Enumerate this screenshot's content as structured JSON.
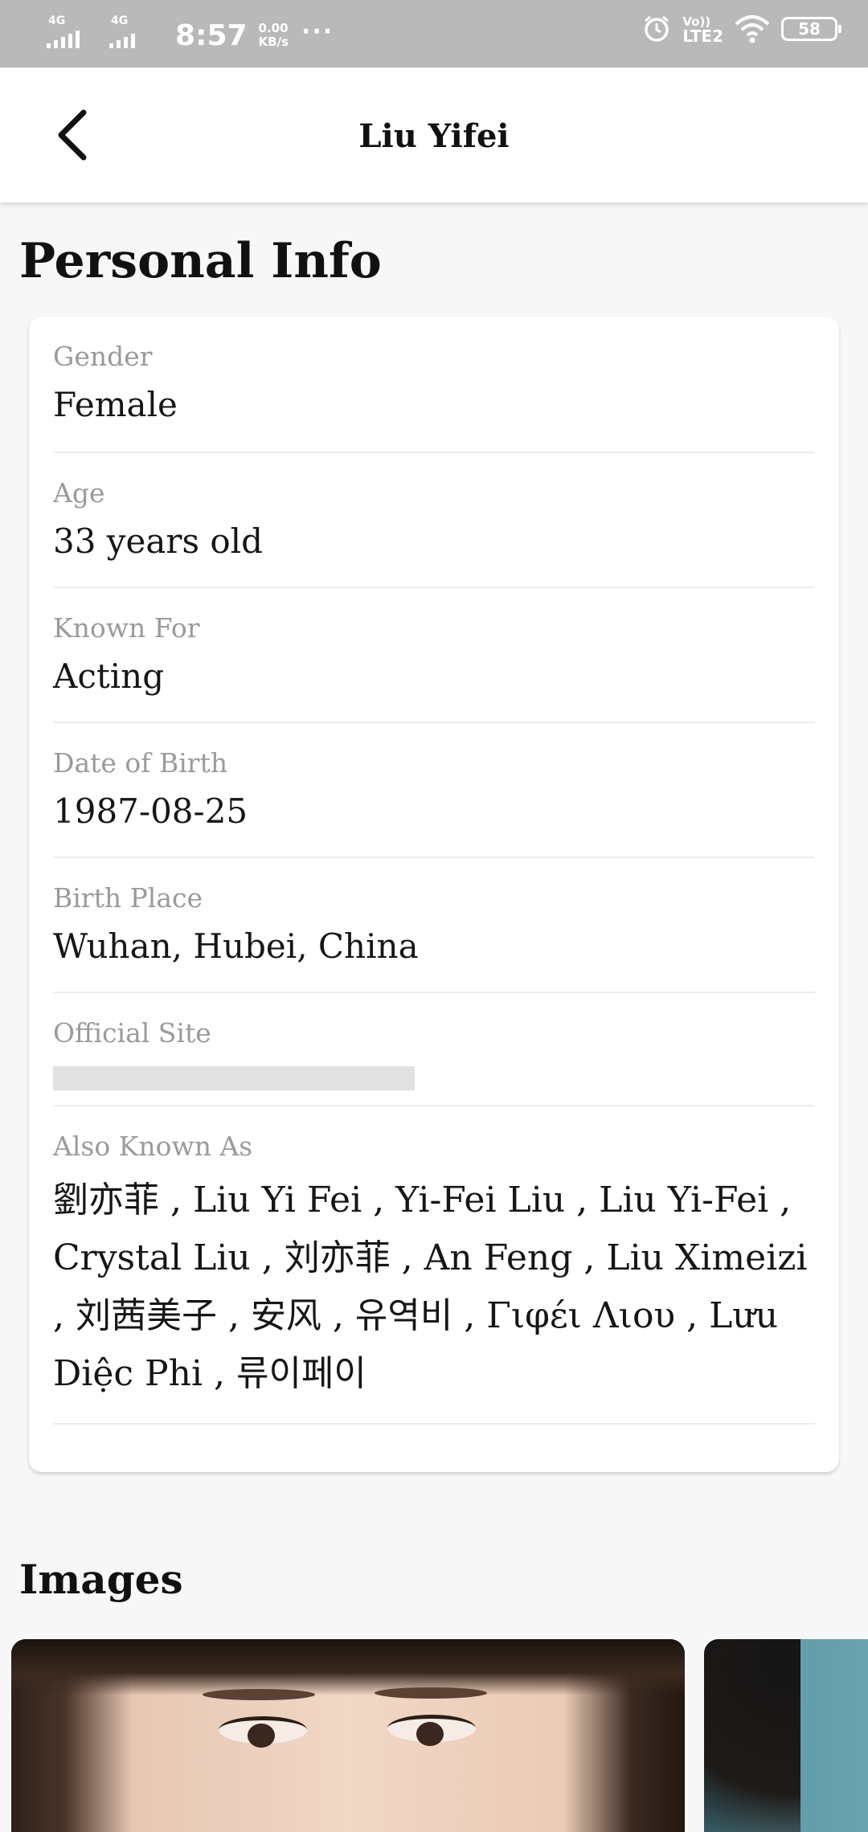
{
  "status_bar": {
    "network1": "4G",
    "network2": "4G",
    "time": "8:57",
    "speed_value": "0.00",
    "speed_unit": "KB/s",
    "more": "···",
    "lte_top": "Vo))",
    "lte_bottom": "LTE2",
    "battery": "58",
    "icons": [
      "alarm-icon",
      "wifi-icon",
      "battery-icon"
    ]
  },
  "app_bar": {
    "title": "Liu Yifei",
    "back_icon": "chevron-left-icon"
  },
  "personal_info": {
    "heading": "Personal Info",
    "fields": [
      {
        "label": "Gender",
        "value": "Female"
      },
      {
        "label": "Age",
        "value": "33 years old"
      },
      {
        "label": "Known For",
        "value": "Acting"
      },
      {
        "label": "Date of Birth",
        "value": "1987-08-25"
      },
      {
        "label": "Birth Place",
        "value": "Wuhan, Hubei, China"
      },
      {
        "label": "Official Site",
        "value": ""
      }
    ],
    "aka": {
      "label": "Also Known As",
      "value": "劉亦菲 , Liu Yi Fei , Yi-Fei Liu , Liu Yi-Fei , Crystal Liu , 刘亦菲 , An Feng , Liu Ximeizi , 刘茜美子 , 安风 , 유역비 , Γιφέι Λιου , Lưu Diệc Phi , 류이페이"
    }
  },
  "images": {
    "heading": "Images"
  }
}
